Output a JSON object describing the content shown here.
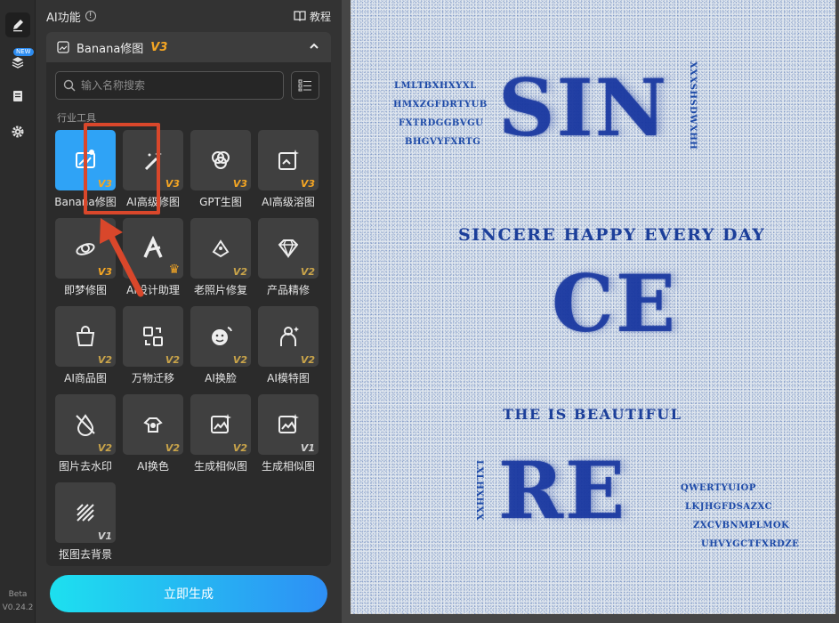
{
  "rail": {
    "badge_new": "NEW",
    "beta": "Beta",
    "version": "V0.24.2"
  },
  "header": {
    "title": "AI功能",
    "tutorial": "教程"
  },
  "section": {
    "title": "Banana修图",
    "version": "V3"
  },
  "search": {
    "placeholder": "输入名称搜索"
  },
  "category": "行业工具",
  "tools": [
    {
      "label": "Banana修图",
      "version": "V3",
      "icon": "image-edit-icon",
      "selected": true
    },
    {
      "label": "AI高级修图",
      "version": "V3",
      "icon": "magic-wand-icon"
    },
    {
      "label": "GPT生图",
      "version": "V3",
      "icon": "gpt-logo-icon"
    },
    {
      "label": "AI高级溶图",
      "version": "V3",
      "icon": "image-sparkle-icon"
    },
    {
      "label": "即梦修图",
      "version": "V3",
      "icon": "dream-icon"
    },
    {
      "label": "AI设计助理",
      "version": "",
      "icon": "design-assistant-icon",
      "crown": true
    },
    {
      "label": "老照片修复",
      "version": "V2",
      "icon": "photo-repair-icon"
    },
    {
      "label": "产品精修",
      "version": "V2",
      "icon": "diamond-icon"
    },
    {
      "label": "AI商品图",
      "version": "V2",
      "icon": "shopping-bag-icon"
    },
    {
      "label": "万物迁移",
      "version": "V2",
      "icon": "transfer-icon"
    },
    {
      "label": "AI换脸",
      "version": "V2",
      "icon": "face-swap-icon"
    },
    {
      "label": "AI模特图",
      "version": "V2",
      "icon": "model-icon"
    },
    {
      "label": "图片去水印",
      "version": "V2",
      "icon": "watermark-remove-icon"
    },
    {
      "label": "AI换色",
      "version": "V2",
      "icon": "color-change-icon"
    },
    {
      "label": "生成相似图",
      "version": "V2",
      "icon": "similar-image-icon"
    },
    {
      "label": "生成相似图",
      "version": "V1",
      "icon": "similar-image-icon"
    },
    {
      "label": "抠图去背景",
      "version": "V1",
      "icon": "remove-bg-icon"
    }
  ],
  "generate_button": "立即生成",
  "colors": {
    "accent_v3": "#f5a623",
    "accent_v2": "#c9a44a",
    "accent_v1": "#cfcfcf",
    "selected_tile": "#2fa3f6",
    "annotation": "#d9472b"
  },
  "poster": {
    "tl_lines": [
      "LMLTBXHXYXL",
      "HMXZGFDRTYUB",
      "FXTRDGGBVGU",
      "BHGVYFXRTG"
    ],
    "vertical_right": "XXXSHSDWXHH",
    "big1": "SIN",
    "tagline": "SINCERE  HAPPY  EVERY  DAY",
    "big2": "CE",
    "tagline2": "THE  IS  BEAUTIFUL",
    "vertical_left": "LXLHXHXX",
    "big3": "RE",
    "br_lines": [
      "QWERTYUIOP",
      "LKJHGFDSAZXC",
      "ZXCVBNMPLMOK",
      "UHVYGCTFXRDZE"
    ]
  }
}
